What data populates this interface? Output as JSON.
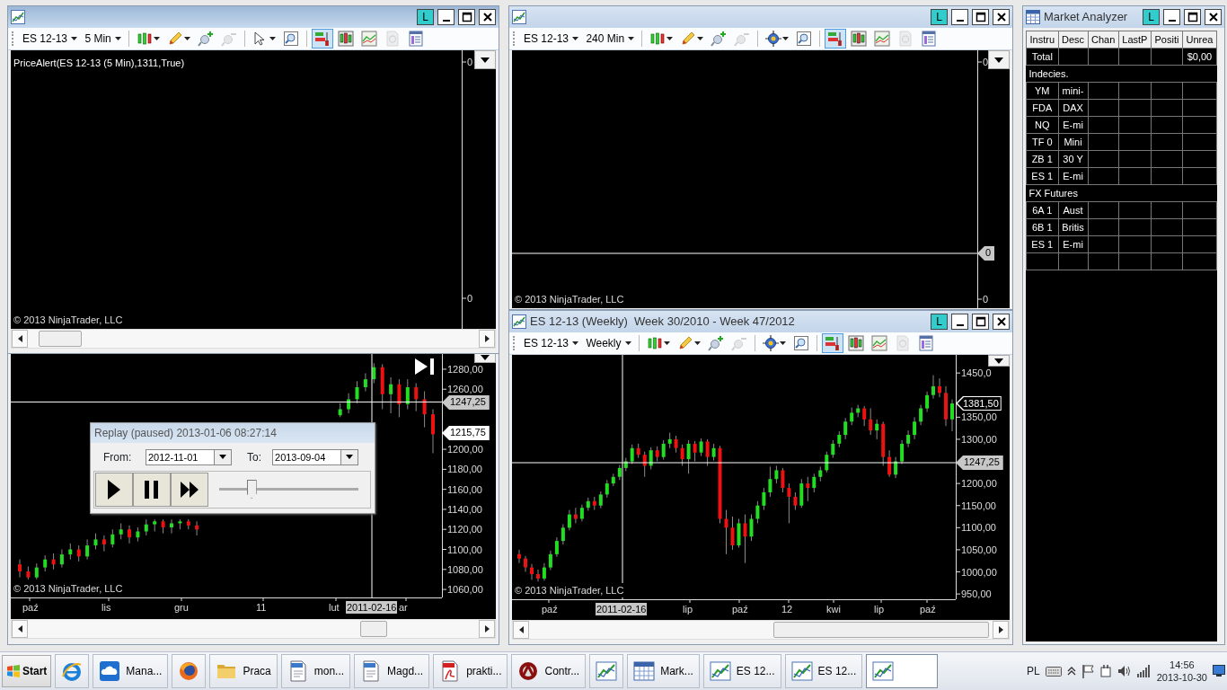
{
  "chart_windows": [
    {
      "link": "L",
      "instrument": "ES 12-13",
      "interval": "5 Min",
      "tools": [
        {
          "kind": "chart-style",
          "dropdown": true,
          "selected": false,
          "disabled": false
        },
        {
          "kind": "draw",
          "dropdown": true,
          "selected": false,
          "disabled": false
        },
        {
          "kind": "zoom-in",
          "dropdown": false,
          "selected": false,
          "disabled": false
        },
        {
          "kind": "zoom-out",
          "dropdown": false,
          "selected": false,
          "disabled": true
        },
        {
          "kind": "pointer",
          "dropdown": true,
          "selected": false,
          "disabled": false
        },
        {
          "kind": "zoom-box",
          "dropdown": false,
          "selected": false,
          "disabled": false
        },
        {
          "kind": "data-box",
          "dropdown": false,
          "selected": true,
          "disabled": false
        },
        {
          "kind": "bars",
          "dropdown": false,
          "selected": false,
          "disabled": false
        },
        {
          "kind": "indicators",
          "dropdown": false,
          "selected": false,
          "disabled": false
        },
        {
          "kind": "performance",
          "dropdown": false,
          "selected": false,
          "disabled": true
        },
        {
          "kind": "properties",
          "dropdown": false,
          "selected": false,
          "disabled": false
        }
      ],
      "indicator_label": "PriceAlert(ES 12-13 (5 Min),1311,True)",
      "y_labels": [
        "0",
        "0"
      ],
      "copyright": "© 2013 NinjaTrader, LLC"
    },
    {
      "markers": [
        {
          "text": "1247,25",
          "kind": "crosshair"
        },
        {
          "text": "1215,75",
          "kind": "last"
        }
      ],
      "x_labels": [
        {
          "text": "paź",
          "kind": "tick"
        },
        {
          "text": "lis",
          "kind": "tick"
        },
        {
          "text": "gru",
          "kind": "tick"
        },
        {
          "text": "11",
          "kind": "tick"
        },
        {
          "text": "lut",
          "kind": "tick"
        },
        {
          "text": "2011-02-16",
          "kind": "crosshair"
        },
        {
          "text": "ar",
          "kind": "tick"
        }
      ],
      "copyright": "© 2013 NinjaTrader, LLC",
      "chart_data": {
        "type": "candlestick",
        "ylim": [
          1052,
          1297
        ],
        "ref_lines": [
          {
            "axis": "y",
            "value": 1247.25
          }
        ],
        "yticks": [
          {
            "value": 1280,
            "label": "1280,00"
          },
          {
            "value": 1260,
            "label": "1260,00"
          },
          {
            "value": 1200,
            "label": "1200,00"
          },
          {
            "value": 1180,
            "label": "1180,00"
          },
          {
            "value": 1160,
            "label": "1160,00"
          },
          {
            "value": 1140,
            "label": "1140,00"
          },
          {
            "value": 1120,
            "label": "1120,00"
          },
          {
            "value": 1100,
            "label": "1100,00"
          },
          {
            "value": 1080,
            "label": "1080,00"
          },
          {
            "value": 1060,
            "label": "1060,00"
          }
        ],
        "ohlc": [
          [
            1085,
            1090,
            1072,
            1078
          ],
          [
            1078,
            1083,
            1070,
            1072
          ],
          [
            1072,
            1086,
            1070,
            1082
          ],
          [
            1082,
            1094,
            1078,
            1090
          ],
          [
            1090,
            1096,
            1080,
            1085
          ],
          [
            1085,
            1100,
            1082,
            1095
          ],
          [
            1095,
            1106,
            1090,
            1100
          ],
          [
            1100,
            1104,
            1088,
            1093
          ],
          [
            1093,
            1110,
            1090,
            1104
          ],
          [
            1104,
            1116,
            1100,
            1110
          ],
          [
            1110,
            1114,
            1098,
            1105
          ],
          [
            1105,
            1120,
            1102,
            1115
          ],
          [
            1115,
            1126,
            1110,
            1120
          ],
          [
            1120,
            1124,
            1106,
            1112
          ],
          [
            1112,
            1122,
            1108,
            1118
          ],
          [
            1118,
            1130,
            1114,
            1125
          ],
          [
            1125,
            1130,
            1118,
            1128
          ],
          [
            1128,
            1130,
            1116,
            1122
          ],
          [
            1122,
            1130,
            1116,
            1126
          ],
          [
            1126,
            1130,
            1120,
            1128
          ],
          [
            1128,
            1130,
            1120,
            1124
          ],
          [
            1124,
            1128,
            1114,
            1120
          ],
          null,
          null,
          null,
          null,
          null,
          null,
          null,
          null,
          null,
          null,
          null,
          null,
          null,
          null,
          null,
          null,
          [
            1234,
            1246,
            1232,
            1240
          ],
          [
            1240,
            1256,
            1236,
            1250
          ],
          [
            1250,
            1268,
            1246,
            1262
          ],
          [
            1262,
            1276,
            1258,
            1270
          ],
          [
            1270,
            1286,
            1266,
            1282
          ],
          [
            1282,
            1285,
            1240,
            1255
          ],
          [
            1255,
            1272,
            1236,
            1265
          ],
          [
            1265,
            1270,
            1232,
            1245
          ],
          [
            1245,
            1270,
            1240,
            1262
          ],
          [
            1262,
            1266,
            1238,
            1250
          ],
          [
            1250,
            1258,
            1222,
            1235
          ],
          [
            1235,
            1240,
            1196,
            1215
          ]
        ]
      }
    },
    {
      "link": "L",
      "instrument": "ES 12-13",
      "interval": "240 Min",
      "tools": [
        {
          "kind": "chart-style",
          "dropdown": true,
          "selected": false,
          "disabled": false
        },
        {
          "kind": "draw",
          "dropdown": true,
          "selected": false,
          "disabled": false
        },
        {
          "kind": "zoom-in",
          "dropdown": false,
          "selected": false,
          "disabled": false
        },
        {
          "kind": "zoom-out",
          "dropdown": false,
          "selected": false,
          "disabled": true
        },
        {
          "kind": "crosshair",
          "dropdown": true,
          "selected": false,
          "disabled": false
        },
        {
          "kind": "zoom-box",
          "dropdown": false,
          "selected": false,
          "disabled": false
        },
        {
          "kind": "data-box",
          "dropdown": false,
          "selected": true,
          "disabled": false
        },
        {
          "kind": "bars",
          "dropdown": false,
          "selected": false,
          "disabled": false
        },
        {
          "kind": "indicators",
          "dropdown": false,
          "selected": false,
          "disabled": false
        },
        {
          "kind": "performance",
          "dropdown": false,
          "selected": false,
          "disabled": true
        },
        {
          "kind": "properties",
          "dropdown": false,
          "selected": false,
          "disabled": false
        }
      ],
      "y_labels": [
        "0",
        "0"
      ],
      "markers": [
        {
          "text": "0",
          "kind": "crosshair"
        }
      ],
      "copyright": "© 2013 NinjaTrader, LLC"
    },
    {
      "title": "ES 12-13 (Weekly)  Week 30/2010 - Week 47/2012",
      "link": "L",
      "instrument": "ES 12-13",
      "interval": "Weekly",
      "tools": [
        {
          "kind": "chart-style",
          "dropdown": true,
          "selected": false,
          "disabled": false
        },
        {
          "kind": "draw",
          "dropdown": true,
          "selected": false,
          "disabled": false
        },
        {
          "kind": "zoom-in",
          "dropdown": false,
          "selected": false,
          "disabled": false
        },
        {
          "kind": "zoom-out",
          "dropdown": false,
          "selected": false,
          "disabled": true
        },
        {
          "kind": "crosshair",
          "dropdown": true,
          "selected": false,
          "disabled": false
        },
        {
          "kind": "zoom-box",
          "dropdown": false,
          "selected": false,
          "disabled": false
        },
        {
          "kind": "data-box",
          "dropdown": false,
          "selected": true,
          "disabled": false
        },
        {
          "kind": "bars",
          "dropdown": false,
          "selected": false,
          "disabled": false
        },
        {
          "kind": "indicators",
          "dropdown": false,
          "selected": false,
          "disabled": false
        },
        {
          "kind": "performance",
          "dropdown": false,
          "selected": false,
          "disabled": true
        },
        {
          "kind": "properties",
          "dropdown": false,
          "selected": false,
          "disabled": false
        }
      ],
      "markers": [
        {
          "text": "1381,50",
          "kind": "close"
        },
        {
          "text": "1247,25",
          "kind": "crosshair"
        }
      ],
      "x_labels": [
        {
          "text": "paź",
          "kind": "tick"
        },
        {
          "text": "2011-02-16",
          "kind": "crosshair"
        },
        {
          "text": "lip",
          "kind": "tick"
        },
        {
          "text": "paź",
          "kind": "tick"
        },
        {
          "text": "12",
          "kind": "tick"
        },
        {
          "text": "kwi",
          "kind": "tick"
        },
        {
          "text": "lip",
          "kind": "tick"
        },
        {
          "text": "paź",
          "kind": "tick"
        }
      ],
      "copyright": "© 2013 NinjaTrader, LLC",
      "chart_data": {
        "type": "candlestick",
        "ylim": [
          938,
          1491
        ],
        "yticks": [
          {
            "value": 1450,
            "label": "1450,0"
          },
          {
            "value": 1350,
            "label": "1350,00"
          },
          {
            "value": 1300,
            "label": "1300,00"
          },
          {
            "value": 1200,
            "label": "1200,00"
          },
          {
            "value": 1150,
            "label": "1150,00"
          },
          {
            "value": 1100,
            "label": "1100,00"
          },
          {
            "value": 1050,
            "label": "1050,00"
          },
          {
            "value": 1000,
            "label": "1000,00"
          },
          {
            "value": 950,
            "label": "950,00"
          }
        ],
        "ohlc": [
          [
            1040,
            1050,
            1020,
            1030
          ],
          [
            1030,
            1036,
            1000,
            1010
          ],
          [
            1010,
            1018,
            982,
            995
          ],
          [
            995,
            1005,
            978,
            985
          ],
          [
            985,
            1020,
            980,
            1010
          ],
          [
            1010,
            1048,
            1004,
            1040
          ],
          [
            1040,
            1078,
            1034,
            1070
          ],
          [
            1070,
            1108,
            1062,
            1100
          ],
          [
            1100,
            1140,
            1094,
            1130
          ],
          [
            1130,
            1145,
            1110,
            1120
          ],
          [
            1120,
            1152,
            1114,
            1145
          ],
          [
            1145,
            1168,
            1138,
            1160
          ],
          [
            1160,
            1170,
            1140,
            1150
          ],
          [
            1150,
            1182,
            1144,
            1175
          ],
          [
            1175,
            1208,
            1168,
            1200
          ],
          [
            1200,
            1222,
            1194,
            1215
          ],
          [
            1215,
            1242,
            1208,
            1235
          ],
          [
            1235,
            1258,
            1228,
            1250
          ],
          [
            1250,
            1288,
            1244,
            1280
          ],
          [
            1280,
            1290,
            1258,
            1265
          ],
          [
            1265,
            1272,
            1215,
            1240
          ],
          [
            1240,
            1282,
            1232,
            1275
          ],
          [
            1275,
            1284,
            1250,
            1260
          ],
          [
            1260,
            1298,
            1254,
            1290
          ],
          [
            1290,
            1315,
            1280,
            1300
          ],
          [
            1300,
            1308,
            1270,
            1280
          ],
          [
            1280,
            1288,
            1240,
            1255
          ],
          [
            1255,
            1298,
            1222,
            1290
          ],
          [
            1290,
            1296,
            1250,
            1270
          ],
          [
            1270,
            1302,
            1262,
            1295
          ],
          [
            1295,
            1300,
            1240,
            1260
          ],
          [
            1260,
            1290,
            1252,
            1280
          ],
          [
            1280,
            1285,
            1110,
            1120
          ],
          [
            1120,
            1140,
            1040,
            1100
          ],
          [
            1100,
            1125,
            1050,
            1060
          ],
          [
            1060,
            1120,
            1055,
            1110
          ],
          [
            1110,
            1130,
            1020,
            1080
          ],
          [
            1080,
            1130,
            1070,
            1120
          ],
          [
            1120,
            1160,
            1110,
            1150
          ],
          [
            1150,
            1190,
            1140,
            1180
          ],
          [
            1180,
            1238,
            1170,
            1210
          ],
          [
            1210,
            1240,
            1200,
            1230
          ],
          [
            1230,
            1235,
            1180,
            1190
          ],
          [
            1190,
            1200,
            1110,
            1170
          ],
          [
            1170,
            1180,
            1140,
            1150
          ],
          [
            1150,
            1210,
            1145,
            1200
          ],
          [
            1200,
            1215,
            1160,
            1190
          ],
          [
            1190,
            1222,
            1180,
            1215
          ],
          [
            1215,
            1238,
            1205,
            1230
          ],
          [
            1230,
            1272,
            1225,
            1265
          ],
          [
            1265,
            1298,
            1258,
            1290
          ],
          [
            1290,
            1318,
            1282,
            1310
          ],
          [
            1310,
            1348,
            1300,
            1340
          ],
          [
            1340,
            1372,
            1332,
            1360
          ],
          [
            1360,
            1378,
            1350,
            1370
          ],
          [
            1370,
            1375,
            1330,
            1345
          ],
          [
            1345,
            1370,
            1310,
            1320
          ],
          [
            1320,
            1345,
            1300,
            1335
          ],
          [
            1335,
            1340,
            1240,
            1260
          ],
          [
            1260,
            1275,
            1215,
            1220
          ],
          [
            1220,
            1260,
            1212,
            1250
          ],
          [
            1250,
            1298,
            1244,
            1290
          ],
          [
            1290,
            1320,
            1282,
            1310
          ],
          [
            1310,
            1350,
            1300,
            1340
          ],
          [
            1340,
            1378,
            1332,
            1370
          ],
          [
            1370,
            1408,
            1362,
            1400
          ],
          [
            1400,
            1445,
            1392,
            1420
          ],
          [
            1420,
            1438,
            1395,
            1405
          ],
          [
            1405,
            1420,
            1330,
            1345
          ],
          [
            1345,
            1390,
            1318,
            1381
          ]
        ]
      }
    }
  ],
  "market_analyzer": {
    "title": "Market Analyzer",
    "link": "L",
    "columns": [
      "Instru",
      "Desc",
      "Chan",
      "LastP",
      "Positi",
      "Unrea"
    ],
    "total": {
      "label": "Total",
      "unrealized": "$0,00"
    },
    "groups": [
      {
        "name": "Indecies.",
        "rows": [
          {
            "instrument": "YM",
            "description": "mini-"
          },
          {
            "instrument": "FDA",
            "description": "DAX"
          },
          {
            "instrument": "NQ",
            "description": "E-mi"
          },
          {
            "instrument": "TF 0",
            "description": "Mini"
          },
          {
            "instrument": "ZB 1",
            "description": "30 Y"
          },
          {
            "instrument": "ES 1",
            "description": "E-mi"
          }
        ]
      },
      {
        "name": "FX Futures",
        "rows": [
          {
            "instrument": "6A 1",
            "description": "Aust"
          },
          {
            "instrument": "6B 1",
            "description": "Britis"
          },
          {
            "instrument": "ES 1",
            "description": "E-mi"
          }
        ]
      }
    ]
  },
  "replay": {
    "title": "Replay (paused) 2013-01-06 08:27:14",
    "from_label": "From:",
    "from": "2012-11-01",
    "to_label": "To:",
    "to": "2013-09-04",
    "speed": {
      "level": 0.23
    }
  },
  "taskbar": {
    "start": "Start",
    "items": [
      {
        "kind": "browser-e",
        "selected": false
      },
      {
        "kind": "cloud",
        "label": "Mana...",
        "selected": false
      },
      {
        "kind": "globe",
        "selected": false
      },
      {
        "kind": "folder",
        "label": "Praca",
        "selected": false
      },
      {
        "kind": "doc",
        "label": "mon...",
        "selected": false
      },
      {
        "kind": "doc",
        "label": "Magd...",
        "selected": false
      },
      {
        "kind": "pdf",
        "label": "prakti...",
        "selected": false
      },
      {
        "kind": "ring",
        "label": "Contr...",
        "selected": false
      },
      {
        "kind": "chart",
        "selected": false
      },
      {
        "kind": "grid",
        "label": "Mark...",
        "selected": false
      },
      {
        "kind": "chart",
        "label": "ES 12...",
        "selected": false
      },
      {
        "kind": "chart",
        "label": "ES 12...",
        "selected": false
      },
      {
        "kind": "chart",
        "selected": true
      }
    ],
    "language": "PL",
    "time": "14:56",
    "date": "2013-10-30"
  }
}
